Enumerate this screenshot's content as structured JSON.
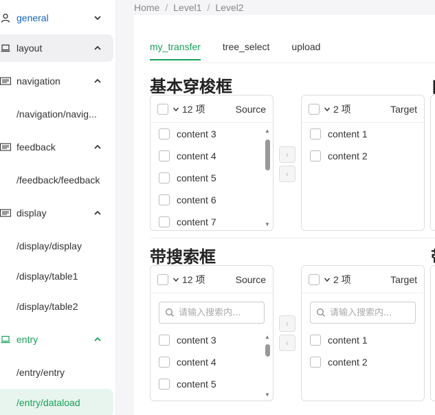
{
  "sidebar": {
    "items": [
      {
        "label": "general",
        "icon": "user-icon",
        "arrow": "chevron-down-icon"
      },
      {
        "label": "layout",
        "icon": "laptop-icon",
        "arrow": "chevron-up-icon"
      },
      {
        "label": "navigation",
        "icon": "menu-card-icon",
        "arrow": "chevron-up-icon"
      },
      {
        "label": "/navigation/navig..."
      },
      {
        "label": "feedback",
        "icon": "menu-card-icon",
        "arrow": "chevron-up-icon"
      },
      {
        "label": "/feedback/feedback"
      },
      {
        "label": "display",
        "icon": "menu-card-icon",
        "arrow": "chevron-up-icon"
      },
      {
        "label": "/display/display"
      },
      {
        "label": "/display/table1"
      },
      {
        "label": "/display/table2"
      },
      {
        "label": "entry",
        "icon": "laptop-icon",
        "arrow": "chevron-up-icon"
      },
      {
        "label": "/entry/entry"
      },
      {
        "label": "/entry/dataload"
      }
    ]
  },
  "breadcrumb": {
    "items": [
      "Home",
      "Level1",
      "Level2"
    ],
    "separator": "/"
  },
  "tabs": [
    {
      "label": "my_transfer",
      "active": true
    },
    {
      "label": "tree_select"
    },
    {
      "label": "upload"
    }
  ],
  "section1": {
    "title": "基本穿梭框",
    "source": {
      "count": "12 项",
      "title": "Source",
      "items": [
        "content 3",
        "content 4",
        "content 5",
        "content 6",
        "content 7"
      ]
    },
    "target": {
      "count": "2 项",
      "title": "Target",
      "items": [
        "content 1",
        "content 2"
      ]
    },
    "right_partial_title": "自"
  },
  "section2": {
    "title": "带搜索框",
    "source": {
      "count": "12 项",
      "title": "Source",
      "search_placeholder": "请输入搜索内...",
      "items": [
        "content 3",
        "content 4",
        "content 5"
      ]
    },
    "target": {
      "count": "2 项",
      "title": "Target",
      "search_placeholder": "请输入搜索内...",
      "items": [
        "content 1",
        "content 2"
      ]
    },
    "right_partial_title": "带"
  },
  "buttons": {
    "to_right": "›",
    "to_left": "‹"
  },
  "colors": {
    "accent": "#18a058",
    "link_blue": "#1565c0",
    "selected_bg": "#e7f5ee",
    "hover_bg": "#f0f0f2"
  }
}
